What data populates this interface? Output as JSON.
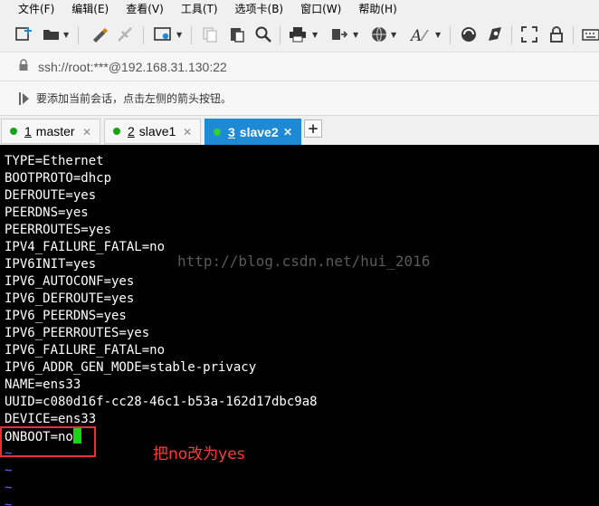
{
  "menu": [
    "文件(F)",
    "编辑(E)",
    "查看(V)",
    "工具(T)",
    "选项卡(B)",
    "窗口(W)",
    "帮助(H)"
  ],
  "toolbar": {
    "icons": [
      "new-session-icon",
      "open-folder-icon",
      "properties-icon",
      "connect-icon",
      "settings-icon",
      "copy-icon",
      "paste-icon",
      "find-icon",
      "print-icon",
      "transfer-icon",
      "globe-icon",
      "font-icon",
      "logo-icon",
      "script-icon",
      "fullscreen-icon",
      "lock-icon",
      "keyboard-icon"
    ]
  },
  "address": {
    "text": "ssh://root:***@192.168.31.130:22"
  },
  "hint": {
    "text": "要添加当前会话，点击左侧的箭头按钮。"
  },
  "tabs": [
    {
      "num": "1",
      "label": "master",
      "active": false
    },
    {
      "num": "2",
      "label": "slave1",
      "active": false
    },
    {
      "num": "3",
      "label": "slave2",
      "active": true
    }
  ],
  "terminal": {
    "lines": [
      "TYPE=Ethernet",
      "BOOTPROTO=dhcp",
      "DEFROUTE=yes",
      "PEERDNS=yes",
      "PEERROUTES=yes",
      "IPV4_FAILURE_FATAL=no",
      "IPV6INIT=yes",
      "IPV6_AUTOCONF=yes",
      "IPV6_DEFROUTE=yes",
      "IPV6_PEERDNS=yes",
      "IPV6_PEERROUTES=yes",
      "IPV6_FAILURE_FATAL=no",
      "IPV6_ADDR_GEN_MODE=stable-privacy",
      "NAME=ens33",
      "UUID=c080d16f-cc28-46c1-b53a-162d17dbc9a8",
      "DEVICE=ens33",
      "ONBOOT=no"
    ],
    "tildes": [
      "~",
      "~",
      "~",
      "~"
    ],
    "watermark": "http://blog.csdn.net/hui_2016",
    "annotation": "把no改为yes"
  },
  "colors": {
    "active_tab": "#1e8ad6",
    "cursor": "#17d417",
    "annotation": "#ff3a3a",
    "tilde": "#6a6aff"
  }
}
